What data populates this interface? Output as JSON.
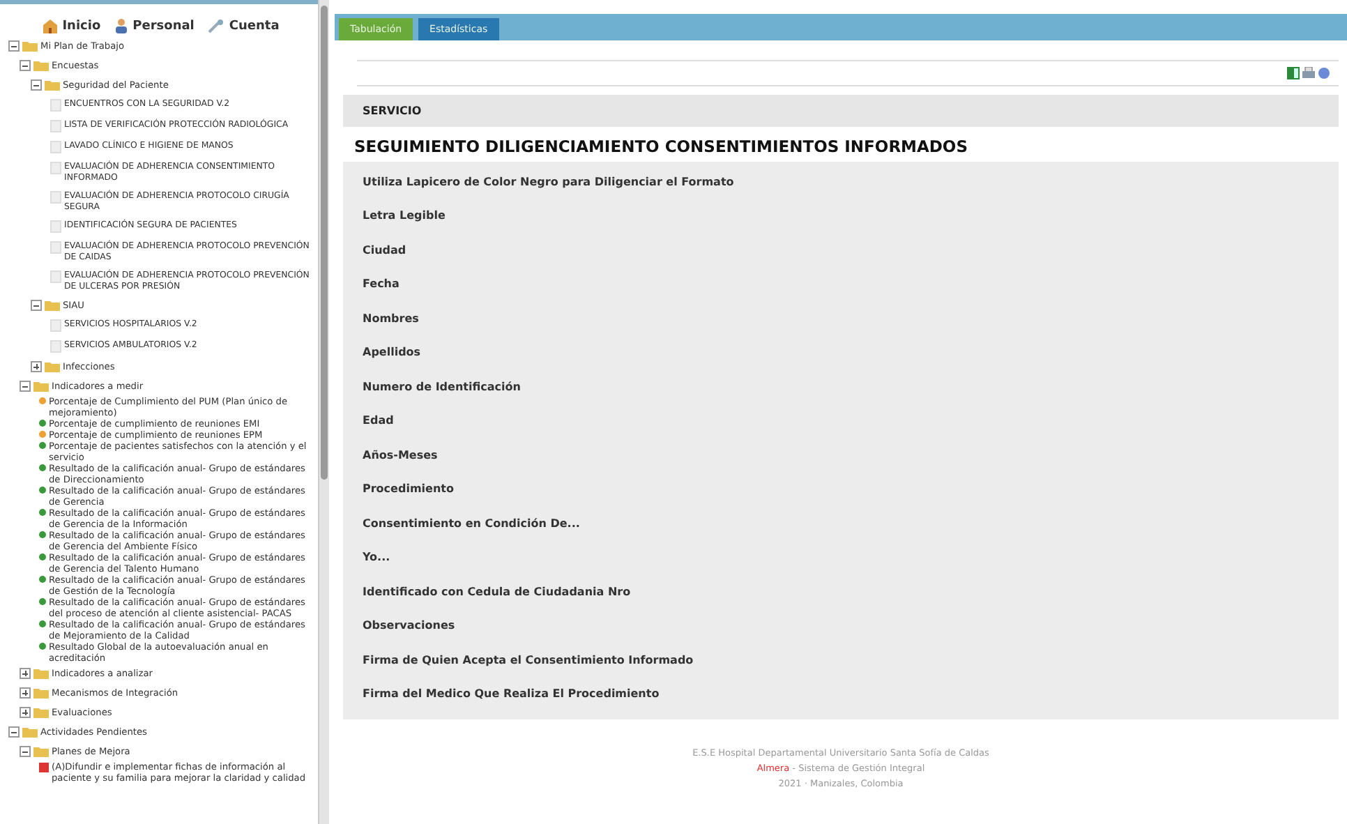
{
  "nav": [
    {
      "label": "Inicio"
    },
    {
      "label": "Personal"
    },
    {
      "label": "Cuenta"
    }
  ],
  "tree": [
    {
      "kind": "folder",
      "label": "Mi Plan de Trabajo",
      "expanded": true,
      "children": [
        {
          "kind": "folder",
          "label": "Encuestas",
          "expanded": true,
          "children": [
            {
              "kind": "folder",
              "label": "Seguridad del Paciente",
              "expanded": true,
              "children": [
                {
                  "kind": "document",
                  "label": "ENCUENTROS CON LA SEGURIDAD V.2"
                },
                {
                  "kind": "document",
                  "label": "LISTA DE VERIFICACIÓN PROTECCIÓN RADIOLÓGICA"
                },
                {
                  "kind": "document",
                  "label": "LAVADO CLÍNICO E HIGIENE DE MANOS"
                },
                {
                  "kind": "document",
                  "label": "EVALUACIÓN DE ADHERENCIA CONSENTIMIENTO INFORMADO"
                },
                {
                  "kind": "document",
                  "label": "EVALUACIÓN DE ADHERENCIA PROTOCOLO CIRUGÍA SEGURA"
                },
                {
                  "kind": "document",
                  "label": "IDENTIFICACIÓN SEGURA DE PACIENTES"
                },
                {
                  "kind": "document",
                  "label": "EVALUACIÓN DE ADHERENCIA PROTOCOLO PREVENCIÓN DE CAIDAS"
                },
                {
                  "kind": "document",
                  "label": "EVALUACIÓN DE ADHERENCIA PROTOCOLO PREVENCIÓN DE ULCERAS POR PRESIÓN"
                }
              ]
            },
            {
              "kind": "folder",
              "label": "SIAU",
              "expanded": true,
              "children": [
                {
                  "kind": "document",
                  "label": "SERVICIOS HOSPITALARIOS V.2"
                },
                {
                  "kind": "document",
                  "label": "SERVICIOS AMBULATORIOS V.2"
                }
              ]
            },
            {
              "kind": "folder",
              "label": "Infecciones",
              "expanded": false
            }
          ]
        },
        {
          "kind": "folder",
          "label": "Indicadores a medir",
          "expanded": true,
          "children": [
            {
              "kind": "indicator",
              "color": "#f0a030",
              "label": "Porcentaje de Cumplimiento del PUM (Plan único de mejoramiento)"
            },
            {
              "kind": "indicator",
              "color": "#3a9a3a",
              "label": "Porcentaje de cumplimiento de reuniones EMI"
            },
            {
              "kind": "indicator",
              "color": "#f0a030",
              "label": "Porcentaje de cumplimiento de reuniones EPM"
            },
            {
              "kind": "indicator",
              "color": "#3a9a3a",
              "label": "Porcentaje de pacientes satisfechos con la atención y el servicio"
            },
            {
              "kind": "indicator",
              "color": "#3a9a3a",
              "label": "Resultado de la calificación anual- Grupo de estándares de Direccionamiento"
            },
            {
              "kind": "indicator",
              "color": "#3a9a3a",
              "label": "Resultado de la calificación anual- Grupo de estándares de Gerencia"
            },
            {
              "kind": "indicator",
              "color": "#3a9a3a",
              "label": "Resultado de la calificación anual- Grupo de estándares de Gerencia de la Información"
            },
            {
              "kind": "indicator",
              "color": "#3a9a3a",
              "label": "Resultado de la calificación anual- Grupo de estándares de Gerencia del Ambiente Físico"
            },
            {
              "kind": "indicator",
              "color": "#3a9a3a",
              "label": "Resultado de la calificación anual- Grupo de estándares de Gerencia del Talento Humano"
            },
            {
              "kind": "indicator",
              "color": "#3a9a3a",
              "label": "Resultado de la calificación anual- Grupo de estándares de Gestión de la Tecnología"
            },
            {
              "kind": "indicator",
              "color": "#3a9a3a",
              "label": "Resultado de la calificación anual- Grupo de estándares del proceso de atención al cliente asistencial- PACAS"
            },
            {
              "kind": "indicator",
              "color": "#3a9a3a",
              "label": "Resultado de la calificación anual- Grupo de estándares de Mejoramiento de la Calidad"
            },
            {
              "kind": "indicator",
              "color": "#3a9a3a",
              "label": "Resultado Global de la autoevaluación anual en acreditación"
            }
          ]
        },
        {
          "kind": "folder",
          "label": "Indicadores a analizar",
          "expanded": false
        },
        {
          "kind": "folder",
          "label": "Mecanismos de Integración",
          "expanded": false
        },
        {
          "kind": "folder",
          "label": "Evaluaciones",
          "expanded": false
        }
      ]
    },
    {
      "kind": "folder",
      "label": "Actividades Pendientes",
      "expanded": true,
      "children": [
        {
          "kind": "folder",
          "label": "Planes de Mejora",
          "expanded": true,
          "children": [
            {
              "kind": "task",
              "label": "(A)Difundir e implementar fichas de información al paciente y su familia para mejorar la claridad y calidad"
            }
          ]
        }
      ]
    }
  ],
  "tabs": [
    {
      "label": "Tabulación",
      "selected": false
    },
    {
      "label": "Estadísticas",
      "selected": true
    }
  ],
  "section": "SERVICIO",
  "title": "SEGUIMIENTO DILIGENCIAMIENTO CONSENTIMIENTOS INFORMADOS",
  "fields": [
    "Utiliza Lapicero de Color Negro para Diligenciar el Formato",
    "Letra Legible",
    "Ciudad",
    "Fecha",
    "Nombres",
    "Apellidos",
    "Numero de Identificación",
    "Edad",
    "Años-Meses",
    "Procedimiento",
    "Consentimiento en Condición De...",
    "Yo...",
    "Identificado con Cedula de Ciudadania Nro",
    "Observaciones",
    "Firma de Quien Acepta el Consentimiento Informado",
    "Firma del Medico Que Realiza El Procedimiento"
  ],
  "footer": {
    "institution": "E.S.E Hospital Departamental Universitario Santa Sofía de Caldas",
    "brand": "Almera",
    "system": "- Sistema de Gestión Integral",
    "location": "2021 · Manizales, Colombia"
  }
}
